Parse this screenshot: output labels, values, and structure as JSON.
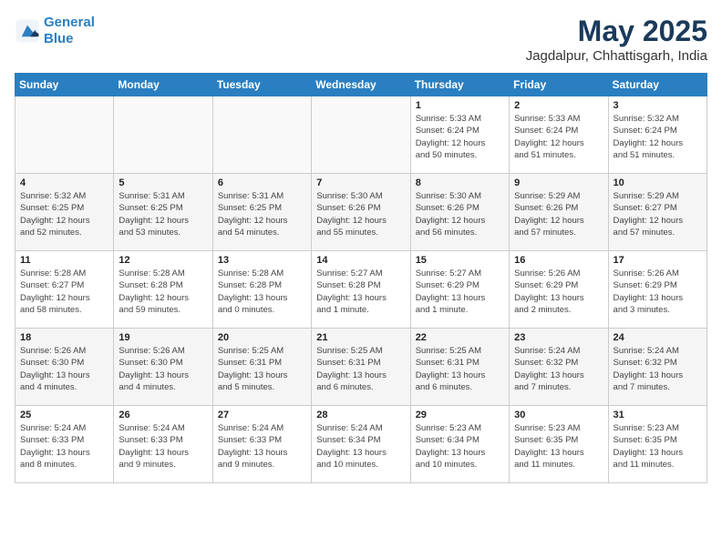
{
  "header": {
    "logo_line1": "General",
    "logo_line2": "Blue",
    "month": "May 2025",
    "location": "Jagdalpur, Chhattisgarh, India"
  },
  "weekdays": [
    "Sunday",
    "Monday",
    "Tuesday",
    "Wednesday",
    "Thursday",
    "Friday",
    "Saturday"
  ],
  "weeks": [
    [
      {
        "day": "",
        "detail": ""
      },
      {
        "day": "",
        "detail": ""
      },
      {
        "day": "",
        "detail": ""
      },
      {
        "day": "",
        "detail": ""
      },
      {
        "day": "1",
        "detail": "Sunrise: 5:33 AM\nSunset: 6:24 PM\nDaylight: 12 hours\nand 50 minutes."
      },
      {
        "day": "2",
        "detail": "Sunrise: 5:33 AM\nSunset: 6:24 PM\nDaylight: 12 hours\nand 51 minutes."
      },
      {
        "day": "3",
        "detail": "Sunrise: 5:32 AM\nSunset: 6:24 PM\nDaylight: 12 hours\nand 51 minutes."
      }
    ],
    [
      {
        "day": "4",
        "detail": "Sunrise: 5:32 AM\nSunset: 6:25 PM\nDaylight: 12 hours\nand 52 minutes."
      },
      {
        "day": "5",
        "detail": "Sunrise: 5:31 AM\nSunset: 6:25 PM\nDaylight: 12 hours\nand 53 minutes."
      },
      {
        "day": "6",
        "detail": "Sunrise: 5:31 AM\nSunset: 6:25 PM\nDaylight: 12 hours\nand 54 minutes."
      },
      {
        "day": "7",
        "detail": "Sunrise: 5:30 AM\nSunset: 6:26 PM\nDaylight: 12 hours\nand 55 minutes."
      },
      {
        "day": "8",
        "detail": "Sunrise: 5:30 AM\nSunset: 6:26 PM\nDaylight: 12 hours\nand 56 minutes."
      },
      {
        "day": "9",
        "detail": "Sunrise: 5:29 AM\nSunset: 6:26 PM\nDaylight: 12 hours\nand 57 minutes."
      },
      {
        "day": "10",
        "detail": "Sunrise: 5:29 AM\nSunset: 6:27 PM\nDaylight: 12 hours\nand 57 minutes."
      }
    ],
    [
      {
        "day": "11",
        "detail": "Sunrise: 5:28 AM\nSunset: 6:27 PM\nDaylight: 12 hours\nand 58 minutes."
      },
      {
        "day": "12",
        "detail": "Sunrise: 5:28 AM\nSunset: 6:28 PM\nDaylight: 12 hours\nand 59 minutes."
      },
      {
        "day": "13",
        "detail": "Sunrise: 5:28 AM\nSunset: 6:28 PM\nDaylight: 13 hours\nand 0 minutes."
      },
      {
        "day": "14",
        "detail": "Sunrise: 5:27 AM\nSunset: 6:28 PM\nDaylight: 13 hours\nand 1 minute."
      },
      {
        "day": "15",
        "detail": "Sunrise: 5:27 AM\nSunset: 6:29 PM\nDaylight: 13 hours\nand 1 minute."
      },
      {
        "day": "16",
        "detail": "Sunrise: 5:26 AM\nSunset: 6:29 PM\nDaylight: 13 hours\nand 2 minutes."
      },
      {
        "day": "17",
        "detail": "Sunrise: 5:26 AM\nSunset: 6:29 PM\nDaylight: 13 hours\nand 3 minutes."
      }
    ],
    [
      {
        "day": "18",
        "detail": "Sunrise: 5:26 AM\nSunset: 6:30 PM\nDaylight: 13 hours\nand 4 minutes."
      },
      {
        "day": "19",
        "detail": "Sunrise: 5:26 AM\nSunset: 6:30 PM\nDaylight: 13 hours\nand 4 minutes."
      },
      {
        "day": "20",
        "detail": "Sunrise: 5:25 AM\nSunset: 6:31 PM\nDaylight: 13 hours\nand 5 minutes."
      },
      {
        "day": "21",
        "detail": "Sunrise: 5:25 AM\nSunset: 6:31 PM\nDaylight: 13 hours\nand 6 minutes."
      },
      {
        "day": "22",
        "detail": "Sunrise: 5:25 AM\nSunset: 6:31 PM\nDaylight: 13 hours\nand 6 minutes."
      },
      {
        "day": "23",
        "detail": "Sunrise: 5:24 AM\nSunset: 6:32 PM\nDaylight: 13 hours\nand 7 minutes."
      },
      {
        "day": "24",
        "detail": "Sunrise: 5:24 AM\nSunset: 6:32 PM\nDaylight: 13 hours\nand 7 minutes."
      }
    ],
    [
      {
        "day": "25",
        "detail": "Sunrise: 5:24 AM\nSunset: 6:33 PM\nDaylight: 13 hours\nand 8 minutes."
      },
      {
        "day": "26",
        "detail": "Sunrise: 5:24 AM\nSunset: 6:33 PM\nDaylight: 13 hours\nand 9 minutes."
      },
      {
        "day": "27",
        "detail": "Sunrise: 5:24 AM\nSunset: 6:33 PM\nDaylight: 13 hours\nand 9 minutes."
      },
      {
        "day": "28",
        "detail": "Sunrise: 5:24 AM\nSunset: 6:34 PM\nDaylight: 13 hours\nand 10 minutes."
      },
      {
        "day": "29",
        "detail": "Sunrise: 5:23 AM\nSunset: 6:34 PM\nDaylight: 13 hours\nand 10 minutes."
      },
      {
        "day": "30",
        "detail": "Sunrise: 5:23 AM\nSunset: 6:35 PM\nDaylight: 13 hours\nand 11 minutes."
      },
      {
        "day": "31",
        "detail": "Sunrise: 5:23 AM\nSunset: 6:35 PM\nDaylight: 13 hours\nand 11 minutes."
      }
    ]
  ]
}
